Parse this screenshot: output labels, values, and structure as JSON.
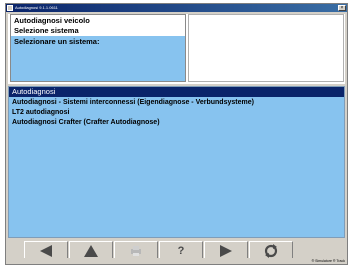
{
  "window": {
    "title": "Autodiagnosi 9.1.1.0611"
  },
  "header": {
    "row1": "Autodiagnosi veicolo",
    "row2": "Selezione sistema",
    "row3": "Selezionare un sistema:"
  },
  "list": {
    "heading": "Autodiagnosi",
    "items": [
      "Autodiagnosi - Sistemi interconnessi (Eigendiagnose - Verbundsysteme)",
      "LT2 autodiagnosi",
      "Autodiagnosi Crafter (Crafter Autodiagnose)"
    ]
  },
  "toolbar": {
    "buttons": [
      "back-arrow",
      "up-arrow",
      "print",
      "help",
      "forward-arrow",
      "refresh"
    ],
    "help_label": "?"
  },
  "statusbar": {
    "text": "® Simulatore  ® Track"
  },
  "colors": {
    "selection": "#0a246a",
    "highlight": "#87c3ef",
    "chrome": "#d4d0c8"
  }
}
